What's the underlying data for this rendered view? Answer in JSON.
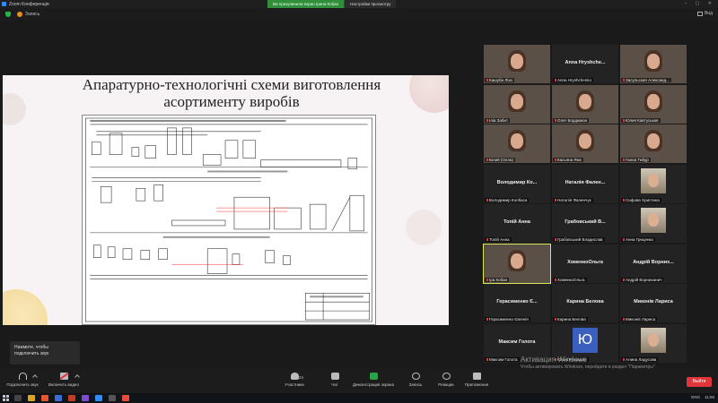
{
  "window": {
    "title": "Zoom Конференція",
    "share_message": "Ви призупинили екран Ірина Кобан",
    "share_options": "Настройки просмотру"
  },
  "top_toolbar": {
    "record_label": "Запись",
    "view_label": "Вид"
  },
  "slide": {
    "title_line1": "Апаратурно-технологічні схеми виготовлення",
    "title_line2": "асортименту виробів"
  },
  "participants": [
    {
      "kind": "video",
      "bottom": "Кашуба Ліза",
      "bg": "a"
    },
    {
      "kind": "name",
      "center": "Anna Hryshche...",
      "bottom": "Anna Hryshchenko"
    },
    {
      "kind": "video",
      "bottom": "Засульская Александ...",
      "bg": "d"
    },
    {
      "kind": "video",
      "bottom": "Іліа Забит",
      "bg": "c"
    },
    {
      "kind": "video",
      "bottom": "Олег Бордюжан",
      "bg": "b"
    },
    {
      "kind": "video",
      "bottom": "Юлия Кавтуськая",
      "bg": "a"
    },
    {
      "kind": "video",
      "bottom": "Білий (Олла)",
      "bg": "b"
    },
    {
      "kind": "video",
      "bottom": "Касьяна Яна",
      "bg": "c"
    },
    {
      "kind": "video",
      "bottom": "Ганна Тибур",
      "bg": "a"
    },
    {
      "kind": "name",
      "center": "Володимир Ко...",
      "bottom": "Володимир Колбаса"
    },
    {
      "kind": "name",
      "center": "Наталія Фален...",
      "bottom": "Наталія Фаленчук"
    },
    {
      "kind": "avatar",
      "bottom": "Сифова Христина"
    },
    {
      "kind": "name",
      "center": "Топій Анна",
      "bottom": "Топій Анна"
    },
    {
      "kind": "name",
      "center": "Грабовський В...",
      "bottom": "Грабовський Владислав"
    },
    {
      "kind": "avatar",
      "bottom": "Анна Гриценко"
    },
    {
      "kind": "video",
      "bottom": "Ірa Кобан",
      "bg": "d",
      "active": true
    },
    {
      "kind": "name",
      "center": "ХоменкоОльга",
      "bottom": "ХоменкоОльга"
    },
    {
      "kind": "name",
      "center": "Андрій Ворних...",
      "bottom": "Андрій Ворниханич"
    },
    {
      "kind": "name",
      "center": "Герасименко Є...",
      "bottom": "Герасименко Євгенія"
    },
    {
      "kind": "name",
      "center": "Карина Белова",
      "bottom": "Карина Белова"
    },
    {
      "kind": "name",
      "center": "Миконів Лариса",
      "bottom": "Миконів Лариса"
    },
    {
      "kind": "name",
      "center": "Максим Голота",
      "bottom": "Максим Голота"
    },
    {
      "kind": "letter",
      "letter": "Ю",
      "bottom": "Юлия Рокицкая"
    },
    {
      "kind": "avatar",
      "bottom": "Алина Ладусова"
    }
  ],
  "tooltip": {
    "line1": "Нажмите, чтобы",
    "line2": "подключить звук"
  },
  "bottom_toolbar": {
    "audio": "Подключить звук",
    "video": "Включить видео",
    "participants": "Участники",
    "participants_count": "24",
    "chat": "Чат",
    "share": "Демонстрация экрана",
    "record": "Запись",
    "reactions": "Реакции",
    "apps": "Приложения",
    "leave": "Выйти"
  },
  "activation": {
    "title": "Активация Windows",
    "subtitle": "Чтобы активировать Windows, перейдите в раздел \"Параметры\"."
  },
  "taskbar": {
    "lang": "ENG",
    "time": "11:56"
  },
  "colors": {
    "share_green": "#2f8f3a",
    "leave_red": "#e0353b",
    "active_outline": "#d8e85a",
    "avatar_blue": "#3b5fbf"
  }
}
